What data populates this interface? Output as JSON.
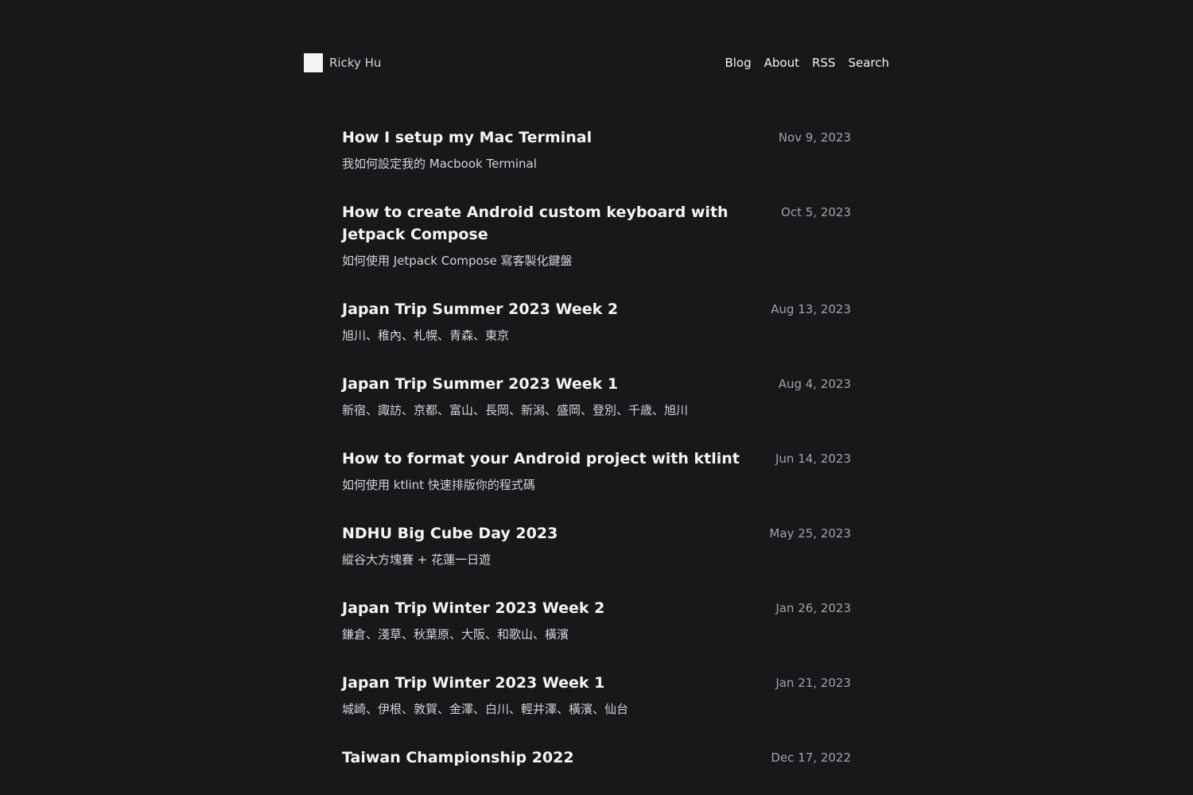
{
  "site": {
    "name": "Ricky Hu"
  },
  "nav": [
    {
      "label": "Blog"
    },
    {
      "label": "About"
    },
    {
      "label": "RSS"
    },
    {
      "label": "Search"
    }
  ],
  "posts": [
    {
      "title": "How I setup my Mac Terminal",
      "description": "我如何設定我的 Macbook Terminal",
      "date": "Nov 9, 2023"
    },
    {
      "title": "How to create Android custom keyboard with Jetpack Compose",
      "description": "如何使用 Jetpack Compose 寫客製化鍵盤",
      "date": "Oct 5, 2023"
    },
    {
      "title": "Japan Trip Summer 2023 Week 2",
      "description": "旭川、稚內、札幌、青森、東京",
      "date": "Aug 13, 2023"
    },
    {
      "title": "Japan Trip Summer 2023 Week 1",
      "description": "新宿、諏訪、京都、富山、長岡、新潟、盛岡、登別、千歳、旭川",
      "date": "Aug 4, 2023"
    },
    {
      "title": "How to format your Android project with ktlint",
      "description": "如何使用 ktlint 快速排版你的程式碼",
      "date": "Jun 14, 2023"
    },
    {
      "title": "NDHU Big Cube Day 2023",
      "description": "縱谷大方塊賽 + 花蓮一日遊",
      "date": "May 25, 2023"
    },
    {
      "title": "Japan Trip Winter 2023 Week 2",
      "description": "鎌倉、淺草、秋葉原、大阪、和歌山、橫濱",
      "date": "Jan 26, 2023"
    },
    {
      "title": "Japan Trip Winter 2023 Week 1",
      "description": "城崎、伊根、敦賀、金澤、白川、輕井澤、橫濱、仙台",
      "date": "Jan 21, 2023"
    },
    {
      "title": "Taiwan Championship 2022",
      "description": "",
      "date": "Dec 17, 2022"
    }
  ]
}
